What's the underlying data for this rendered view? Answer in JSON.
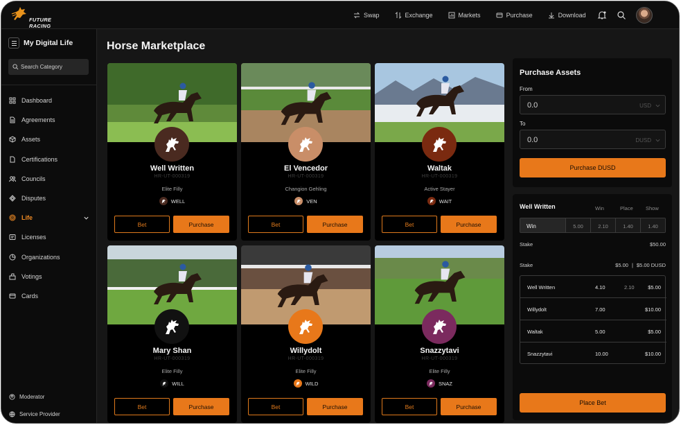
{
  "brand": {
    "logo_text": "FUTURE RACING",
    "accent": "#e8781a"
  },
  "topnav": [
    {
      "label": "Swap",
      "icon": "swap-icon"
    },
    {
      "label": "Exchange",
      "icon": "exchange-icon"
    },
    {
      "label": "Markets",
      "icon": "chart-icon"
    },
    {
      "label": "Purchase",
      "icon": "cart-icon"
    },
    {
      "label": "Download",
      "icon": "download-icon"
    }
  ],
  "sidebar": {
    "title": "My Digital Life",
    "search_placeholder": "Search Category",
    "items": [
      {
        "label": "Dashboard",
        "icon": "grid-icon"
      },
      {
        "label": "Agreements",
        "icon": "file-icon"
      },
      {
        "label": "Assets",
        "icon": "cube-icon"
      },
      {
        "label": "Certifications",
        "icon": "doc-icon"
      },
      {
        "label": "Councils",
        "icon": "users-icon"
      },
      {
        "label": "Disputes",
        "icon": "diamond-icon"
      },
      {
        "label": "Life",
        "icon": "target-icon",
        "active": true
      },
      {
        "label": "Licenses",
        "icon": "license-icon"
      },
      {
        "label": "Organizations",
        "icon": "pie-icon"
      },
      {
        "label": "Votings",
        "icon": "vote-icon"
      },
      {
        "label": "Cards",
        "icon": "card-icon"
      }
    ],
    "footer": [
      {
        "label": "Moderator",
        "icon": "user-circle-icon"
      },
      {
        "label": "Service Provider",
        "icon": "globe-icon"
      }
    ]
  },
  "main": {
    "title": "Horse Marketplace",
    "bet_label": "Bet",
    "purchase_label": "Purchase",
    "horses": [
      {
        "name": "Well Written",
        "id": "HR-UT-000319",
        "type": "Elite Filly",
        "tag": "WELL",
        "badge": "#4a2a20"
      },
      {
        "name": "El Vencedor",
        "id": "HR-UT-000319",
        "type": "Changion Gehling",
        "tag": "VEN",
        "badge": "#c98e68"
      },
      {
        "name": "Waltak",
        "id": "HR-UT-000319",
        "type": "Active Stayer",
        "tag": "WAIT",
        "badge": "#7a2a10"
      },
      {
        "name": "Mary Shan",
        "id": "HR-UT-000319",
        "type": "Elite Filly",
        "tag": "WILL",
        "badge": "#111111"
      },
      {
        "name": "Willydolt",
        "id": "HR-UT-000319",
        "type": "Elite Filly",
        "tag": "WILD",
        "badge": "#e8781a"
      },
      {
        "name": "Snazzytavi",
        "id": "HR-UT-000319",
        "type": "Elite Filly",
        "tag": "SNAZ",
        "badge": "#7b2a5e"
      }
    ]
  },
  "purchase": {
    "title": "Purchase Assets",
    "from_label": "From",
    "from_value": "0.0",
    "from_currency": "USD",
    "to_label": "To",
    "to_value": "0.0",
    "to_currency": "DUSD",
    "button": "Purchase DUSD"
  },
  "betslip": {
    "horse": "Well Written",
    "columns": [
      "Win",
      "Place",
      "Show"
    ],
    "row_label": "Win",
    "odds": [
      "5.00",
      "2.10",
      "1.40",
      "1.40"
    ],
    "stake_label": "Stake",
    "stake_value": "$50.00",
    "stake2_label": "Stake",
    "stake2_value": "$5.00",
    "stake2_sep": "|",
    "stake2_value2": "$5.00 DUSD",
    "bets": [
      {
        "name": "Well Written",
        "odd": "4.10",
        "odd2": "2.10",
        "amount": "$5.00"
      },
      {
        "name": "Willydolt",
        "odd": "7.00",
        "odd2": "",
        "amount": "$10.00"
      },
      {
        "name": "Waltak",
        "odd": "5.00",
        "odd2": "",
        "amount": "$5.00"
      },
      {
        "name": "Snazzytavi",
        "odd": "10.00",
        "odd2": "",
        "amount": "$10.00"
      }
    ],
    "place_bet": "Place Bet"
  }
}
